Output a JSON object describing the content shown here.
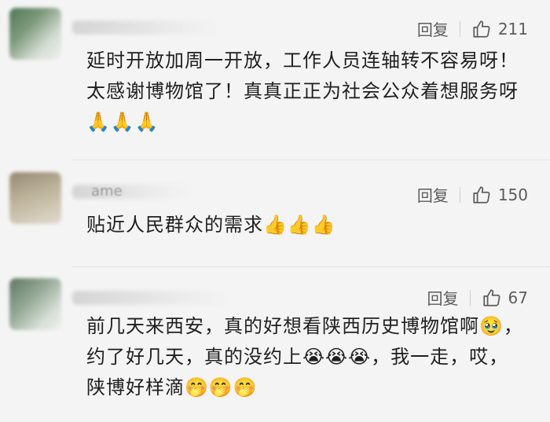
{
  "comments": [
    {
      "reply_label": "回复",
      "like_count": "211",
      "text": "延时开放加周一开放，工作人员连轴转不容易呀！太感谢博物馆了！真真正正为社会公众着想服务呀🙏🙏🙏"
    },
    {
      "name_visible_fragment": "ame",
      "reply_label": "回复",
      "like_count": "150",
      "text": "贴近人民群众的需求👍👍👍"
    },
    {
      "reply_label": "回复",
      "like_count": "67",
      "text": "前几天来西安，真的好想看陕西历史博物馆啊🥹，约了好几天，真的没约上😭😭😭，我一走，哎，陕博好样滴🤭🤭🤭"
    }
  ],
  "icons": {
    "like": "thumbs-up-outline-icon",
    "avatar": "blurred-avatar"
  },
  "colors": {
    "background": "#f4f4f4",
    "action_text": "#5c5c5c",
    "body_text": "#1f1f1f"
  }
}
